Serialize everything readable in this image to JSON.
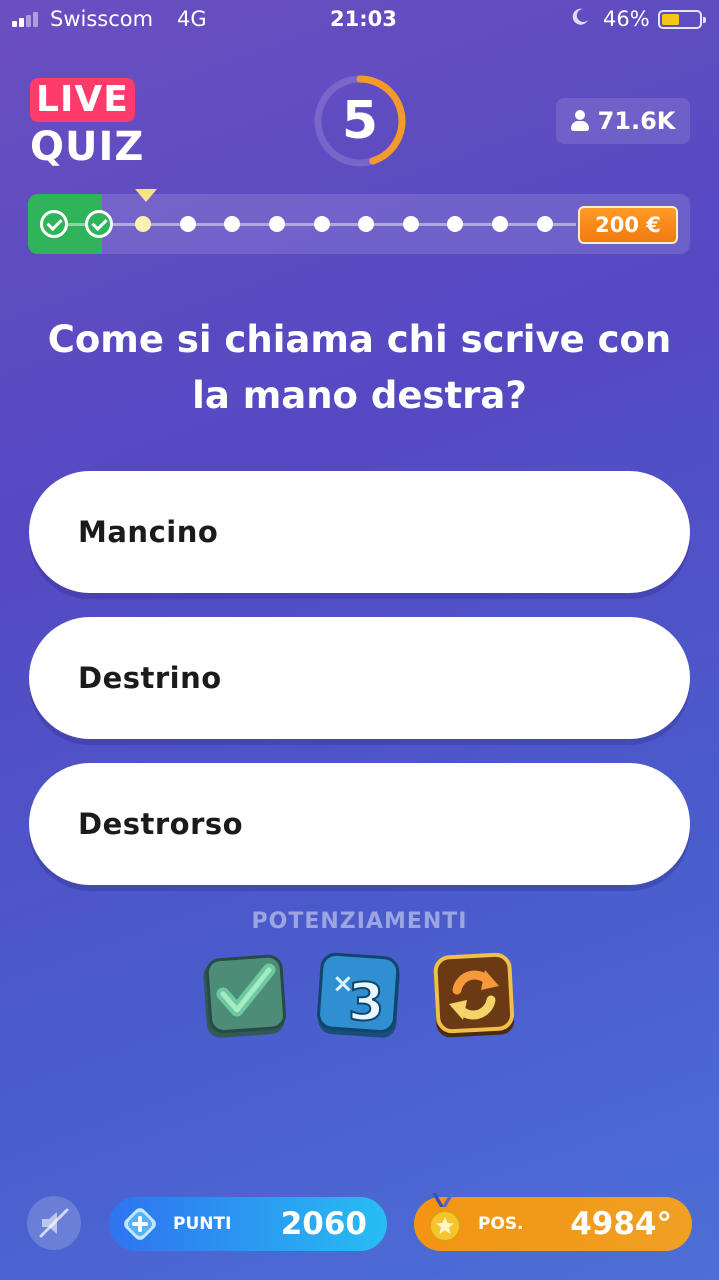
{
  "status_bar": {
    "carrier": "Swisscom",
    "network": "4G",
    "time": "21:03",
    "battery_percent": "46%",
    "battery_level": 0.46,
    "signal_bars_filled": 2
  },
  "header": {
    "logo_live": "LIVE",
    "logo_quiz": "QUIZ",
    "timer": "5",
    "timer_progress": 0.45,
    "viewers": "71.6K"
  },
  "progress": {
    "completed": 2,
    "total": 12,
    "current": 3,
    "prize": "200 €"
  },
  "question": "Come si chiama chi scrive con la mano destra?",
  "answers": [
    {
      "label": "Mancino"
    },
    {
      "label": "Destrino"
    },
    {
      "label": "Destrorso"
    }
  ],
  "powerups": {
    "label": "POTENZIAMENTI",
    "items": [
      "check-icon",
      "plus-three-icon",
      "refresh-icon"
    ]
  },
  "footer": {
    "points_label": "PUNTI",
    "points_value": "2060",
    "position_label": "POS.",
    "position_value": "4984°"
  },
  "colors": {
    "background": "#5549c2",
    "accent_pink": "#ff3b6b",
    "progress_green": "#2fb45a",
    "timer_orange": "#f39a2b",
    "prize_orange": "#f07a10",
    "points_blue": "#2f73f0",
    "position_orange": "#f39412"
  }
}
